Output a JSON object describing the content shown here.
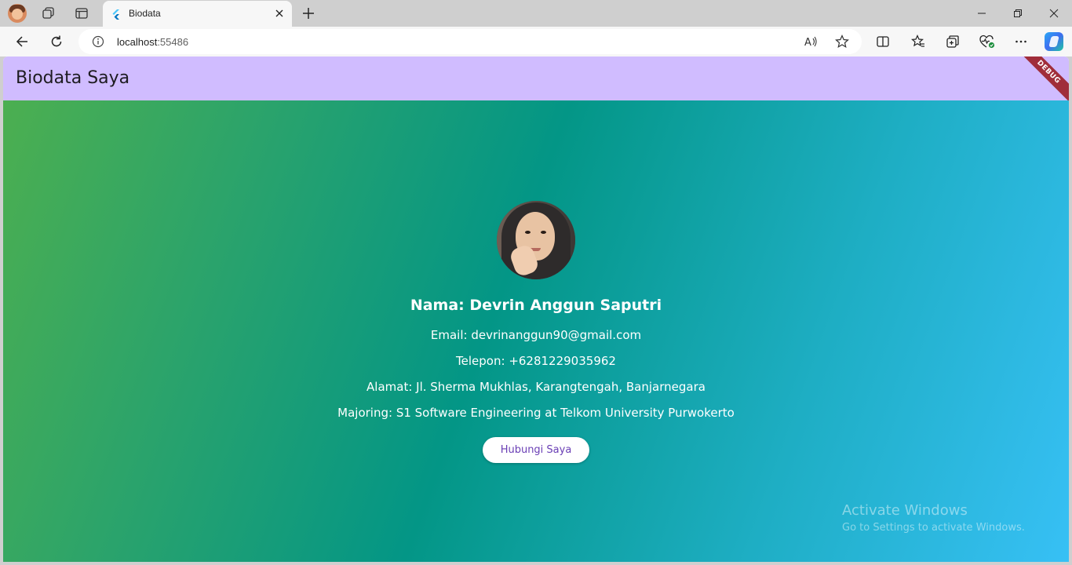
{
  "browser": {
    "tab": {
      "title": "Biodata"
    },
    "address": {
      "host": "localhost",
      "port": ":55486"
    }
  },
  "app": {
    "title": "Biodata Saya",
    "debug_banner": "DEBUG",
    "profile": {
      "name": "Nama: Devrin Anggun Saputri",
      "email": "Email: devrinanggun90@gmail.com",
      "phone": "Telepon: +6281229035962",
      "address": "Alamat: Jl. Sherma Mukhlas, Karangtengah, Banjarnegara",
      "major": "Majoring: S1 Software Engineering at Telkom University Purwokerto"
    },
    "contact_button": "Hubungi Saya"
  },
  "watermark": {
    "title": "Activate Windows",
    "subtitle": "Go to Settings to activate Windows."
  },
  "icons": {
    "appbar_color": "#d0bcff",
    "gradient_start": "#4caf50",
    "gradient_mid": "#039686",
    "gradient_end": "#37c0f5",
    "button_text_color": "#6a3fb5"
  }
}
